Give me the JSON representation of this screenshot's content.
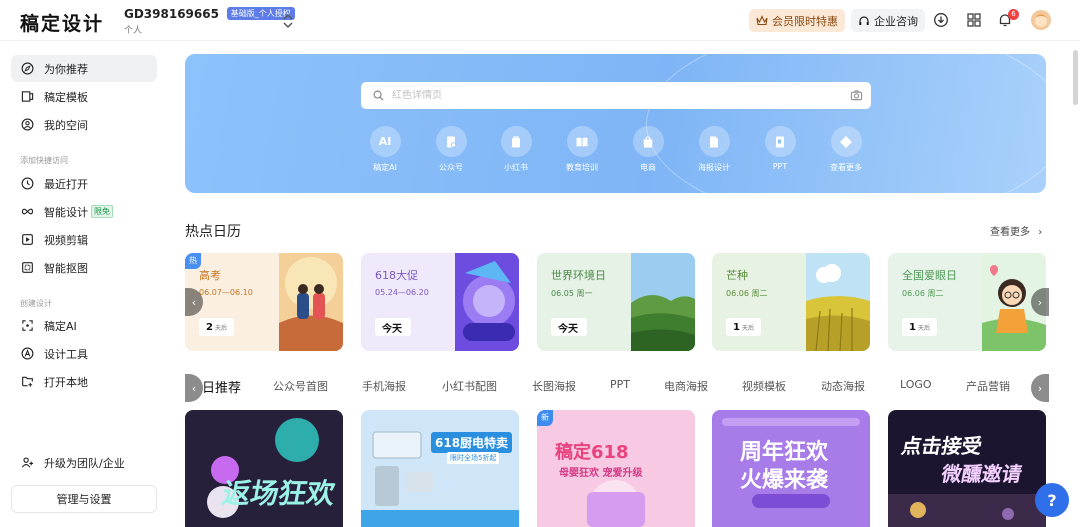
{
  "header": {
    "logo": "稿定设计",
    "account_id": "GD398169665",
    "account_tag": "基础版_个人授权",
    "account_type": "个人",
    "vip_label": "会员限时特惠",
    "enterprise_label": "企业咨询",
    "notification_count": "6"
  },
  "sidebar": {
    "items": [
      {
        "label": "为你推荐",
        "icon": "compass-icon"
      },
      {
        "label": "稿定模板",
        "icon": "template-icon"
      },
      {
        "label": "我的空间",
        "icon": "user-space-icon"
      }
    ],
    "group_quick": "添加快捷访问",
    "quick_items": [
      {
        "label": "最近打开",
        "icon": "clock-icon"
      },
      {
        "label": "智能设计",
        "icon": "infinity-icon",
        "tag": "限免"
      },
      {
        "label": "视频剪辑",
        "icon": "video-icon"
      },
      {
        "label": "智能抠图",
        "icon": "cutout-icon"
      }
    ],
    "group_create": "创建设计",
    "create_items": [
      {
        "label": "稿定AI",
        "icon": "ai-icon"
      },
      {
        "label": "设计工具",
        "icon": "design-tool-icon"
      },
      {
        "label": "打开本地",
        "icon": "folder-icon"
      }
    ],
    "upgrade_label": "升级为团队/企业",
    "manage_label": "管理与设置"
  },
  "hero": {
    "search_placeholder": "红色详情页",
    "quick_entries": [
      {
        "label": "稿定AI",
        "icon": "ai-icon"
      },
      {
        "label": "公众号",
        "icon": "official-account-icon"
      },
      {
        "label": "小红书",
        "icon": "xiaohongshu-icon"
      },
      {
        "label": "教育培训",
        "icon": "book-icon"
      },
      {
        "label": "电商",
        "icon": "shopping-bag-icon"
      },
      {
        "label": "海报设计",
        "icon": "poster-icon"
      },
      {
        "label": "PPT",
        "icon": "ppt-icon"
      },
      {
        "label": "查看更多",
        "icon": "more-icon"
      }
    ]
  },
  "calendar": {
    "title": "热点日历",
    "see_more": "查看更多",
    "hot_tag": "热",
    "cards": [
      {
        "name": "高考",
        "date": "06.07—06.10",
        "count": "2",
        "unit": "天后",
        "bg": "#fbefe2",
        "color": "#c7731f"
      },
      {
        "name": "618大促",
        "date": "05.24—06.20",
        "count": "今天",
        "unit": "",
        "bg": "#efe9fb",
        "color": "#7a58c8"
      },
      {
        "name": "世界环境日",
        "date": "06.05 周一",
        "count": "今天",
        "unit": "",
        "bg": "#e6f2e6",
        "color": "#4b8a4b"
      },
      {
        "name": "芒种",
        "date": "06.06 周二",
        "count": "1",
        "unit": "天后",
        "bg": "#e8f2e3",
        "color": "#5a8c3a"
      },
      {
        "name": "全国爱眼日",
        "date": "06.06 周二",
        "count": "1",
        "unit": "天后",
        "bg": "#e7f3e8",
        "color": "#4f9a57"
      }
    ]
  },
  "tabs": {
    "active": "日推荐",
    "items": [
      "公众号首图",
      "手机海报",
      "小红书配图",
      "长图海报",
      "PPT",
      "电商海报",
      "视频模板",
      "动态海报",
      "LOGO",
      "产品营销"
    ]
  },
  "templates": {
    "new_tag": "新",
    "cards": [
      {
        "text": "返场狂欢",
        "bg": "#2a1f3d"
      },
      {
        "text": "618厨电特卖",
        "sub": "限时全场5折起",
        "bg": "#cfe6f8"
      },
      {
        "text": "稿定618",
        "sub": "母婴狂欢 宠爱升级",
        "bg": "#f7c9e3"
      },
      {
        "text": "周年狂欢",
        "sub": "火爆来袭",
        "bg": "#a77be8"
      },
      {
        "text": "点击接受",
        "sub": "微醺邀请",
        "bg": "#1c1530"
      }
    ]
  },
  "help_label": "?"
}
